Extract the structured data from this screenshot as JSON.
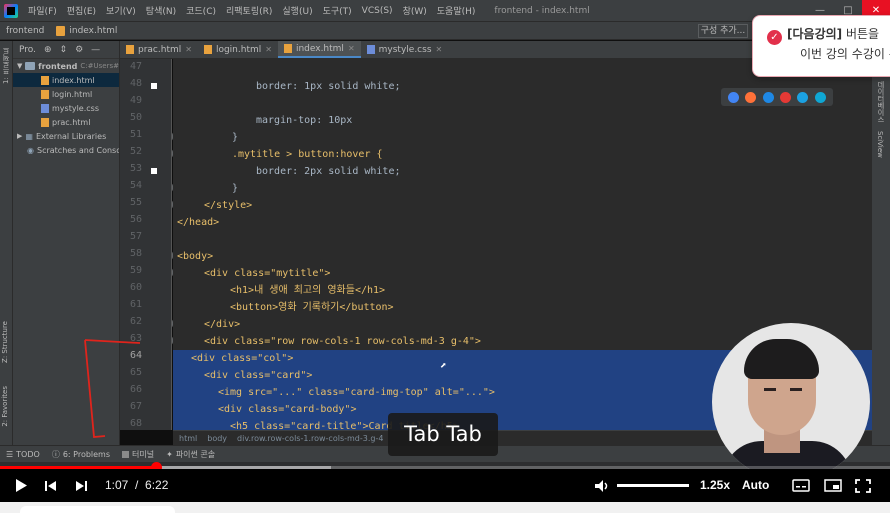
{
  "menu": {
    "items": [
      "파일(F)",
      "편집(E)",
      "보기(V)",
      "탐색(N)",
      "코드(C)",
      "리팩토링(R)",
      "실행(U)",
      "도구(T)",
      "VCS(S)",
      "창(W)",
      "도움말(H)"
    ],
    "window_title": "frontend - index.html"
  },
  "nav": {
    "project": "frontend",
    "file": "index.html",
    "config_button": "구성 추가..."
  },
  "toast": {
    "label": "[다음강의]",
    "line1_rest": " 버튼을",
    "line2": "이번 강의 수강이 완"
  },
  "project_panel": {
    "header": "Pro.",
    "items": [
      {
        "name": "frontend",
        "path": "C:#Users#",
        "type": "folder"
      },
      {
        "name": "index.html",
        "type": "html"
      },
      {
        "name": "login.html",
        "type": "html"
      },
      {
        "name": "mystyle.css",
        "type": "css"
      },
      {
        "name": "prac.html",
        "type": "html"
      },
      {
        "name": "External Libraries",
        "type": "lib"
      },
      {
        "name": "Scratches and Conso",
        "type": "scratch"
      }
    ]
  },
  "side_labels": {
    "project": "1: 프로젝트",
    "structure": "Z: Structure",
    "favorites": "2: Favorites",
    "db": "데이터베이스",
    "sciview": "SciView"
  },
  "tabs": [
    {
      "label": "prac.html",
      "active": false
    },
    {
      "label": "login.html",
      "active": false
    },
    {
      "label": "index.html",
      "active": true
    },
    {
      "label": "mystyle.css",
      "active": false
    }
  ],
  "code_lines": [
    {
      "n": "47",
      "text": ""
    },
    {
      "n": "48",
      "text": "border: 1px solid white;"
    },
    {
      "n": "49",
      "text": ""
    },
    {
      "n": "50",
      "text": "margin-top: 10px"
    },
    {
      "n": "51",
      "text": "}"
    },
    {
      "n": "52",
      "text": ".mytitle > button:hover {"
    },
    {
      "n": "53",
      "text": "border: 2px solid white;"
    },
    {
      "n": "54",
      "text": "}"
    },
    {
      "n": "55",
      "text": "</style>"
    },
    {
      "n": "56",
      "text": "</head>"
    },
    {
      "n": "57",
      "text": ""
    },
    {
      "n": "58",
      "text": "<body>"
    },
    {
      "n": "59",
      "text": "<div class=\"mytitle\">"
    },
    {
      "n": "60",
      "text": "<h1>내 생애 최고의 영화들</h1>"
    },
    {
      "n": "61",
      "text": "<button>영화 기록하기</button>"
    },
    {
      "n": "62",
      "text": "</div>"
    },
    {
      "n": "63",
      "text": "<div class=\"row row-cols-1 row-cols-md-3 g-4\">"
    },
    {
      "n": "64",
      "text": "<div class=\"col\">"
    },
    {
      "n": "65",
      "text": "<div class=\"card\">"
    },
    {
      "n": "66",
      "text": "<img src=\"...\" class=\"card-img-top\" alt=\"...\">"
    },
    {
      "n": "67",
      "text": "<div class=\"card-body\">"
    },
    {
      "n": "68",
      "text": "<h5 class=\"card-title\">Card title</h5>"
    }
  ],
  "breadcrumb": [
    "html",
    "body",
    "div.row.row-cols-1.row-cols-md-3.g-4"
  ],
  "statusbar": [
    "TODO",
    "6: Problems",
    "터미널",
    "파이썬 콘솔"
  ],
  "tooltip": "Tab Tab",
  "player": {
    "current": "1:07",
    "separator": "/",
    "duration": "6:22",
    "speed": "1.25x",
    "quality": "Auto",
    "progress": 0.175,
    "buffered": 0.372
  },
  "colors": {
    "accent_red": "#ff0000",
    "selection": "#214283",
    "toast_check": "#e2304b"
  }
}
